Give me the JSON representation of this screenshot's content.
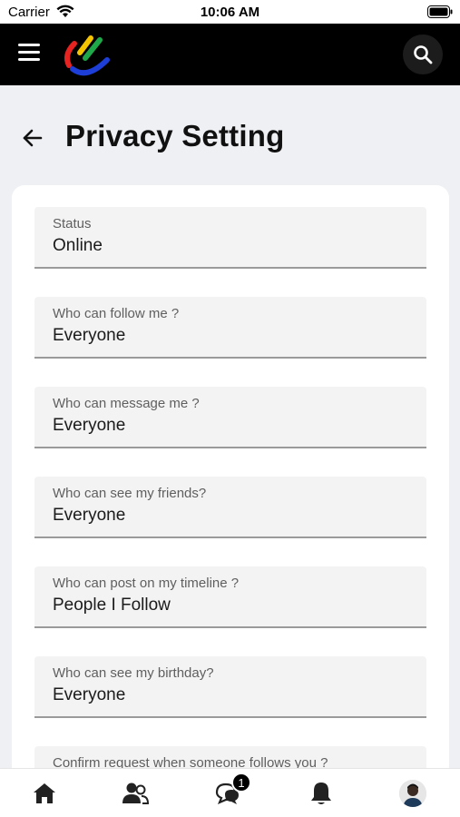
{
  "status_bar": {
    "carrier": "Carrier",
    "time": "10:06 AM"
  },
  "app_bar": {
    "menu_icon": "hamburger-menu-icon",
    "logo": "brand-logo",
    "search_icon": "search-icon"
  },
  "page": {
    "title": "Privacy Setting",
    "back_icon": "back-arrow-icon"
  },
  "fields": [
    {
      "label": "Status",
      "value": "Online"
    },
    {
      "label": "Who can follow me ?",
      "value": "Everyone"
    },
    {
      "label": "Who can message me ?",
      "value": "Everyone"
    },
    {
      "label": "Who can see my friends?",
      "value": "Everyone"
    },
    {
      "label": "Who can post on my timeline ?",
      "value": "People I Follow"
    },
    {
      "label": "Who can see my birthday?",
      "value": "Everyone"
    },
    {
      "label": "Confirm request when someone follows you ?",
      "value": ""
    }
  ],
  "bottom_nav": {
    "items": [
      "home-icon",
      "friends-icon",
      "messages-icon",
      "notifications-icon",
      "profile-avatar"
    ],
    "messages_badge": "1"
  },
  "colors": {
    "app_bar": "#000000",
    "background": "#eef0f3",
    "field_fill": "#f3f3f3"
  }
}
